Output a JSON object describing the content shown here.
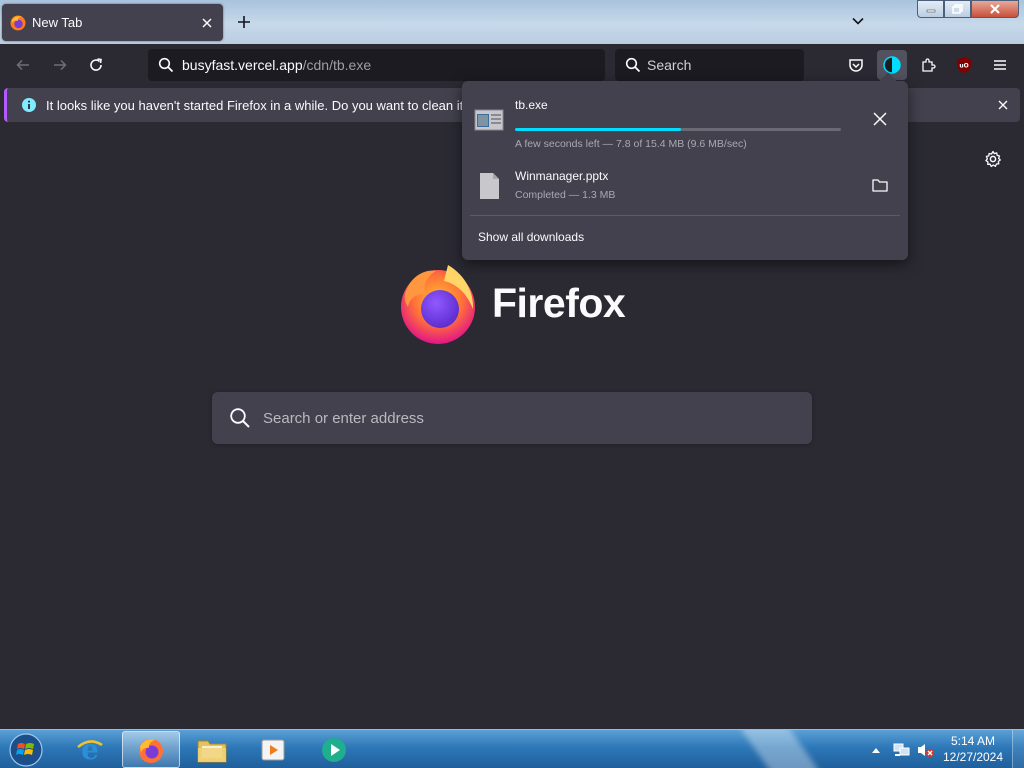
{
  "window": {
    "tab_title": "New Tab"
  },
  "toolbar": {
    "url_host": "busyfast.vercel.app",
    "url_path": "/cdn/tb.exe",
    "search_placeholder": "Search"
  },
  "notification": {
    "message": "It looks like you haven't started Firefox in a while. Do you want to clean it up for"
  },
  "newtab": {
    "brand": "Firefox",
    "search_placeholder": "Search or enter address"
  },
  "downloads": {
    "items": [
      {
        "name": "tb.exe",
        "status": "A few seconds left — 7.8 of 15.4 MB (9.6 MB/sec)",
        "progress": 0.51,
        "icon": "exe-file-icon",
        "action": "cancel-download"
      },
      {
        "name": "Winmanager.pptx",
        "status": "Completed — 1.3 MB",
        "icon": "document-file-icon",
        "action": "show-in-folder"
      }
    ],
    "show_all_label": "Show all downloads"
  },
  "taskbar": {
    "apps": [
      "internet-explorer",
      "firefox",
      "file-explorer",
      "media-player",
      "app-launcher"
    ],
    "active_app": "firefox",
    "clock": {
      "time": "5:14 AM",
      "date": "12/27/2024"
    }
  },
  "colors": {
    "accent": "#00ddff",
    "notification_accent": "#b25aff",
    "chrome_bg": "#2b2a33",
    "panel_bg": "#42414d"
  }
}
